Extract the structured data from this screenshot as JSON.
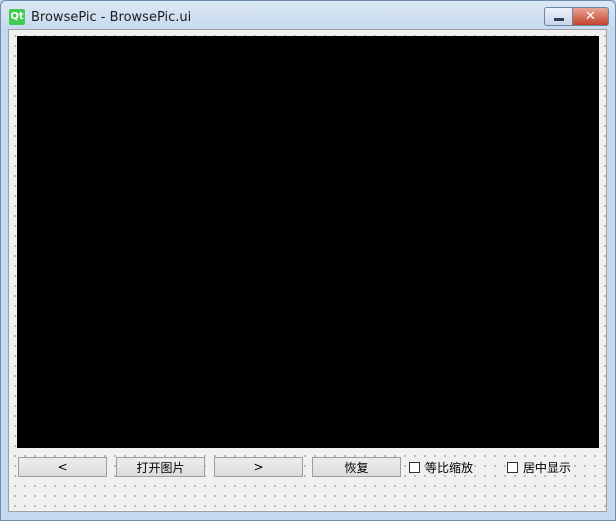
{
  "window": {
    "title": "BrowsePic - BrowsePic.ui",
    "app_icon_text": "Qt",
    "minimize_icon": "minimize-icon",
    "close_glyph": "✕"
  },
  "viewport": {
    "background_color": "#000000"
  },
  "toolbar": {
    "prev_label": "<",
    "open_label": "打开图片",
    "next_label": ">",
    "restore_label": "恢复",
    "keep_ratio_label": "等比缩放",
    "center_label": "居中显示",
    "keep_ratio_checked": false,
    "center_checked": false
  }
}
